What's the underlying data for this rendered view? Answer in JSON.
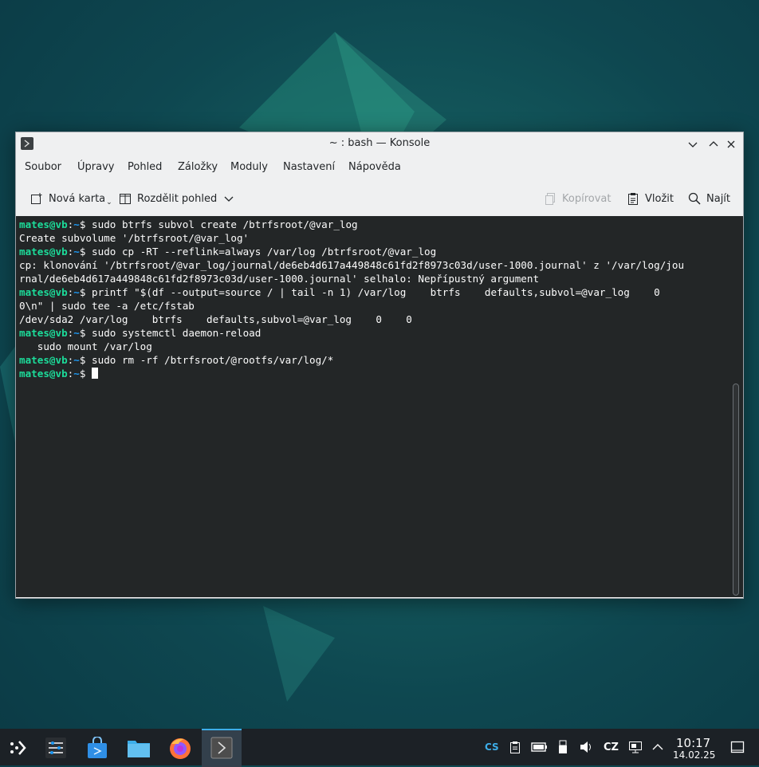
{
  "window": {
    "title": "~ : bash — Konsole",
    "menu": [
      "Soubor",
      "Úpravy",
      "Pohled",
      "Záložky",
      "Moduly",
      "Nastavení",
      "Nápověda"
    ],
    "toolbar": {
      "new_tab": "Nová karta",
      "split_view": "Rozdělit pohled",
      "copy": "Kopírovat",
      "paste": "Vložit",
      "find": "Najít"
    }
  },
  "terminal": {
    "user_host": "mates@vb",
    "path": "~",
    "lines": [
      {
        "type": "prompt",
        "text": "sudo btrfs subvol create /btrfsroot/@var_log"
      },
      {
        "type": "output",
        "text": "Create subvolume '/btrfsroot/@var_log'"
      },
      {
        "type": "prompt",
        "text": "sudo cp -RT --reflink=always /var/log /btrfsroot/@var_log"
      },
      {
        "type": "output",
        "text": "cp: klonování '/btrfsroot/@var_log/journal/de6eb4d617a449848c61fd2f8973c03d/user-1000.journal' z '/var/log/jou"
      },
      {
        "type": "output",
        "text": "rnal/de6eb4d617a449848c61fd2f8973c03d/user-1000.journal' selhalo: Nepřípustný argument"
      },
      {
        "type": "prompt",
        "text": "printf \"$(df --output=source / | tail -n 1) /var/log    btrfs    defaults,subvol=@var_log    0"
      },
      {
        "type": "output",
        "text": "0\\n\" | sudo tee -a /etc/fstab"
      },
      {
        "type": "output",
        "text": "/dev/sda2 /var/log    btrfs    defaults,subvol=@var_log    0    0"
      },
      {
        "type": "prompt",
        "text": "sudo systemctl daemon-reload"
      },
      {
        "type": "output",
        "text": "   sudo mount /var/log"
      },
      {
        "type": "prompt",
        "text": "sudo rm -rf /btrfsroot/@rootfs/var/log/*"
      },
      {
        "type": "prompt",
        "text": ""
      }
    ]
  },
  "taskbar": {
    "apps": [
      "app-launcher-icon",
      "system-settings-icon",
      "discover-icon",
      "dolphin-icon",
      "firefox-icon",
      "konsole-icon"
    ],
    "tray": {
      "lang_indicator": "CS",
      "keyboard_layout": "CZ"
    },
    "clock": {
      "time": "10:17",
      "date": "14.02.25"
    }
  },
  "colors": {
    "prompt": "#1cdc9a",
    "path": "#1d99f3",
    "terminal_bg": "#232627",
    "taskbar_bg": "#1c2126"
  }
}
